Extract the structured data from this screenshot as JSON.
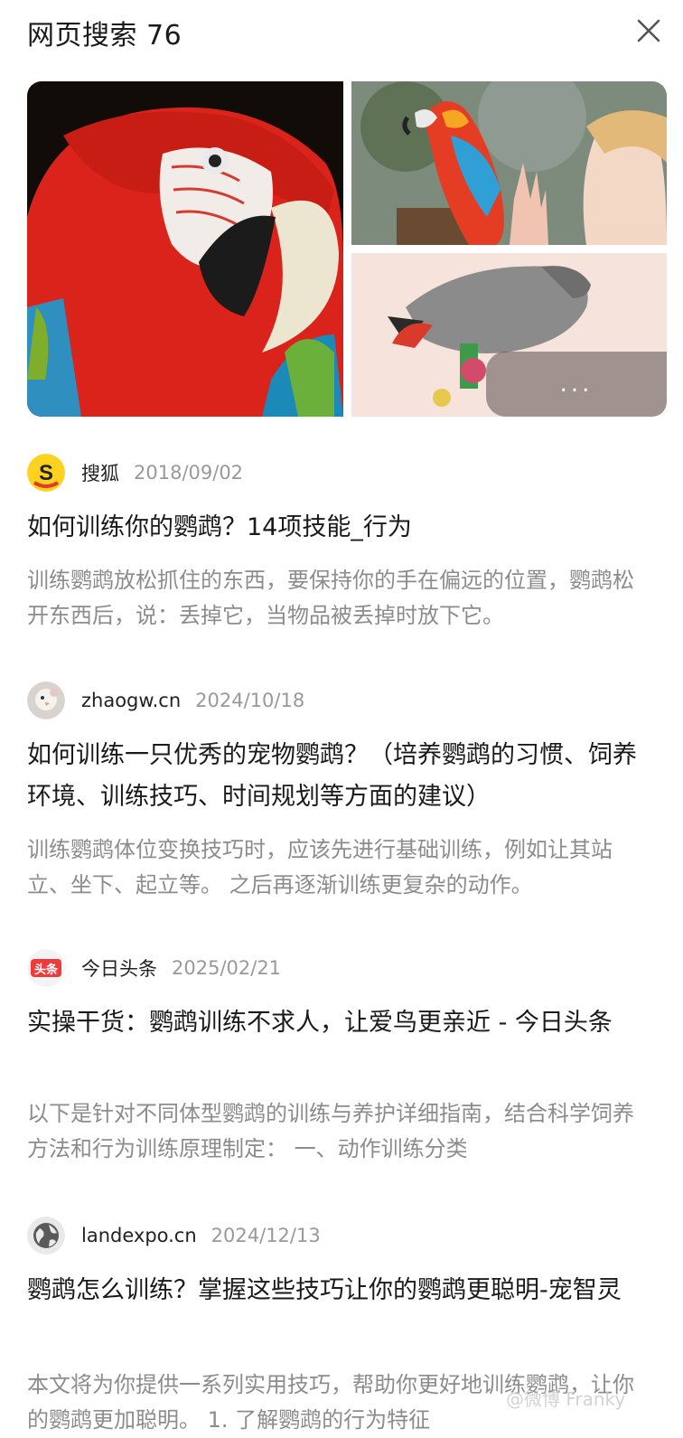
{
  "header": {
    "title": "网页搜索 76"
  },
  "gallery": {
    "more_label": "...",
    "images": [
      {
        "name": "red-macaw-closeup-image"
      },
      {
        "name": "macaw-with-girl-image"
      },
      {
        "name": "grey-parrot-on-perch-image"
      }
    ]
  },
  "results": [
    {
      "source": "搜狐",
      "date": "2018/09/02",
      "icon": "sohu-logo-icon",
      "title": "如何训练你的鹦鹉？14项技能_行为",
      "snippet": "训练鹦鹉放松抓住的东西，要保持你的手在偏远的位置，鹦鹉松开东西后，说：丢掉它，当物品被丢掉时放下它。"
    },
    {
      "source": "zhaogw.cn",
      "date": "2024/10/18",
      "icon": "zhaogw-avatar-icon",
      "title": "如何训练一只优秀的宠物鹦鹉？（培养鹦鹉的习惯、饲养环境、训练技巧、时间规划等方面的建议）",
      "snippet": "训练鹦鹉体位变换技巧时，应该先进行基础训练，例如让其站立、坐下、起立等。 之后再逐渐训练更复杂的动作。"
    },
    {
      "source": "今日头条",
      "date": "2025/02/21",
      "icon": "toutiao-logo-icon",
      "title": "实操干货：鹦鹉训练不求人，让爱鸟更亲近 - 今日头条",
      "snippet": "以下是针对不同体型鹦鹉的训练与养护详细指南，结合科学饲养方法和行为训练原理制定： 一、动作训练分类"
    },
    {
      "source": "landexpo.cn",
      "date": "2024/12/13",
      "icon": "globe-icon",
      "title": "鹦鹉怎么训练？掌握这些技巧让你的鹦鹉更聪明-宠智灵",
      "snippet": "本文将为你提供一系列实用技巧，帮助你更好地训练鹦鹉，让你的鹦鹉更加聪明。 1. 了解鹦鹉的行为特征"
    }
  ],
  "watermark": "@微博 Franky"
}
